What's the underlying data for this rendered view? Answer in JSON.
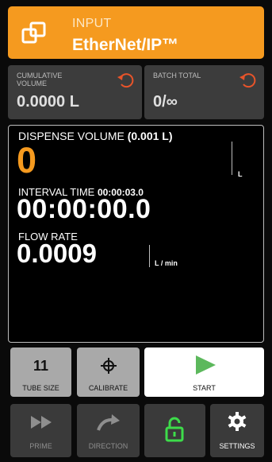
{
  "header": {
    "subtitle": "INPUT",
    "title": "EtherNet/IP™",
    "icon": "network-icon"
  },
  "cumulative": {
    "label": "CUMULATIVE VOLUME",
    "value": "0.0000 L",
    "icon": "reset-icon"
  },
  "batch": {
    "label": "BATCH TOTAL",
    "value": "0/∞",
    "icon": "reset-icon"
  },
  "display": {
    "dispense_label": "DISPENSE VOLUME ",
    "dispense_unit_hint": "(0.001 L)",
    "dispense_value": "0",
    "dispense_unit": "L",
    "interval_label": "INTERVAL TIME ",
    "interval_value": "00:00:03.0",
    "timer": "00:00:00.0",
    "flow_label": "FLOW RATE",
    "flow_value": "0.0009",
    "flow_unit": "L / min"
  },
  "buttons": {
    "tube_size_value": "11",
    "tube_size_label": "TUBE SIZE",
    "calibrate_label": "CALIBRATE",
    "start_label": "START",
    "prime_label": "PRIME",
    "direction_label": "DIRECTION",
    "settings_label": "SETTINGS"
  },
  "colors": {
    "accent": "#f59a1f",
    "start_green": "#5cb85c",
    "lock_green": "#3ddc4a"
  }
}
